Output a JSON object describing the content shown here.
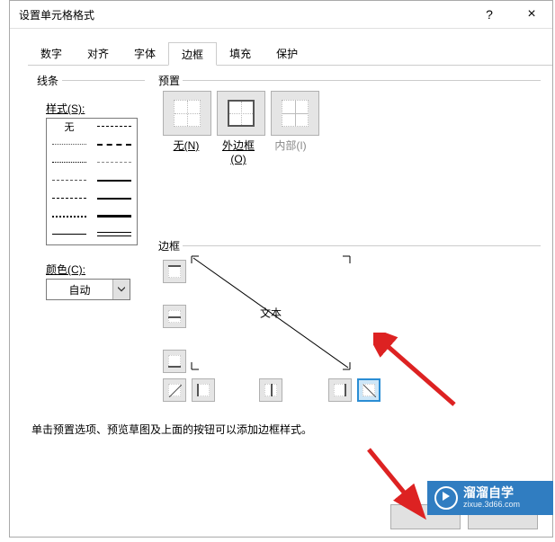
{
  "title": "设置单元格格式",
  "help_char": "?",
  "close_char": "×",
  "tabs": [
    "数字",
    "对齐",
    "字体",
    "边框",
    "填充",
    "保护"
  ],
  "line_section": "线条",
  "style_label": "样式(S):",
  "style_none": "无",
  "color_label": "颜色(C):",
  "color_value": "自动",
  "preset_section": "预置",
  "preset_none": "无(N)",
  "preset_outline": "外边框(O)",
  "preset_inside": "内部(I)",
  "border_section": "边框",
  "preview_text": "文本",
  "instruction": "单击预置选项、预览草图及上面的按钮可以添加边框样式。",
  "watermark": {
    "title": "溜溜自学",
    "sub": "zixue.3d66.com"
  }
}
